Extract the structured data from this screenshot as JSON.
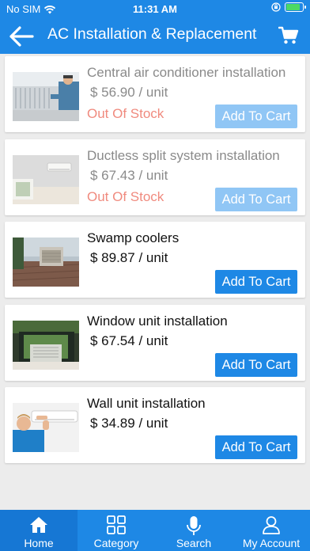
{
  "status_bar": {
    "carrier": "No SIM",
    "time": "11:31 AM"
  },
  "header": {
    "title": "AC Installation & Replacement"
  },
  "products": [
    {
      "name": "Central air conditioner installation",
      "price": "$ 56.90 / unit",
      "stock_status": "Out Of Stock",
      "button_label": "Add To Cart",
      "available": false
    },
    {
      "name": "Ductless split system installation",
      "price": "$ 67.43 / unit",
      "stock_status": "Out Of Stock",
      "button_label": "Add To Cart",
      "available": false
    },
    {
      "name": "Swamp coolers",
      "price": "$ 89.87 / unit",
      "stock_status": "",
      "button_label": "Add To Cart",
      "available": true
    },
    {
      "name": "Window unit installation",
      "price": "$ 67.54 / unit",
      "stock_status": "",
      "button_label": "Add To Cart",
      "available": true
    },
    {
      "name": "Wall unit installation",
      "price": "$ 34.89 / unit",
      "stock_status": "",
      "button_label": "Add To Cart",
      "available": true
    }
  ],
  "tabs": [
    {
      "label": "Home",
      "icon": "home-icon",
      "active": true
    },
    {
      "label": "Category",
      "icon": "grid-icon",
      "active": false
    },
    {
      "label": "Search",
      "icon": "microphone-icon",
      "active": false
    },
    {
      "label": "My Account",
      "icon": "user-icon",
      "active": false
    }
  ],
  "colors": {
    "primary": "#1e88e5",
    "primary_disabled": "#90c6f5",
    "out_of_stock": "#f08a7e",
    "background": "#ececec"
  }
}
